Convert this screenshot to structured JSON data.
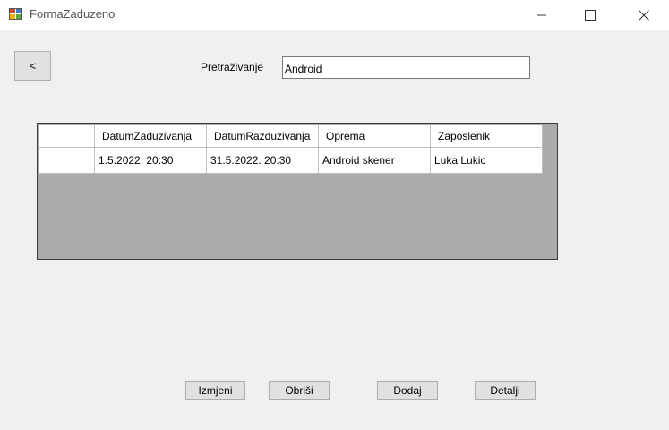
{
  "window": {
    "title": "FormaZaduzeno",
    "minimize_icon": "minimize-icon",
    "maximize_icon": "maximize-icon",
    "close_icon": "close-icon"
  },
  "toolbar": {
    "back_label": "<"
  },
  "search": {
    "label": "Pretraživanje",
    "value": "Android"
  },
  "grid": {
    "columns": [
      "",
      "DatumZaduzivanja",
      "DatumRazduzivanja",
      "Oprema",
      "Zaposlenik"
    ],
    "rows": [
      [
        "",
        "1.5.2022. 20:30",
        "31.5.2022. 20:30",
        "Android skener",
        "Luka Lukic"
      ]
    ]
  },
  "actions": {
    "edit_label": "Izmjeni",
    "delete_label": "Obriši",
    "add_label": "Dodaj",
    "details_label": "Detalji"
  },
  "colors": {
    "form_background": "#f0f0f0",
    "grid_background": "#ababab",
    "button_face": "#e1e1e1"
  }
}
